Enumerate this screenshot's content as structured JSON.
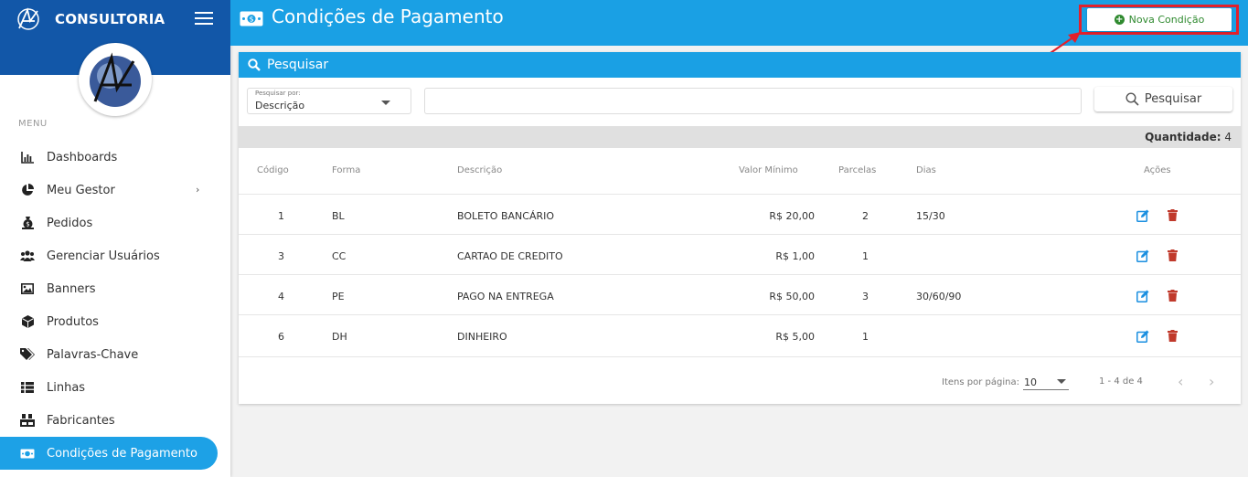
{
  "sidebar": {
    "brand": "CONSULTORIA",
    "menu_label": "MENU",
    "items": [
      {
        "label": "Dashboards",
        "icon": "chart-bar-icon"
      },
      {
        "label": "Meu Gestor",
        "icon": "pie-chart-icon"
      },
      {
        "label": "Pedidos",
        "icon": "money-bag-icon"
      },
      {
        "label": "Gerenciar Usuários",
        "icon": "users-icon"
      },
      {
        "label": "Banners",
        "icon": "image-icon"
      },
      {
        "label": "Produtos",
        "icon": "box-icon"
      },
      {
        "label": "Palavras-Chave",
        "icon": "tags-icon"
      },
      {
        "label": "Linhas",
        "icon": "list-icon"
      },
      {
        "label": "Fabricantes",
        "icon": "pallet-icon"
      },
      {
        "label": "Condições de Pagamento",
        "icon": "money-bill-icon"
      }
    ]
  },
  "header": {
    "title": "Condições de Pagamento",
    "nova_label": "Nova Condição"
  },
  "search": {
    "title": "Pesquisar",
    "select_label": "Pesquisar por:",
    "select_value": "Descrição",
    "button_label": "Pesquisar",
    "quantity_label": "Quantidade:",
    "quantity_value": "4"
  },
  "table": {
    "headers": [
      "Código",
      "Forma",
      "Descrição",
      "Valor Mínimo",
      "Parcelas",
      "Dias",
      "Ações"
    ],
    "rows": [
      {
        "codigo": "1",
        "forma": "BL",
        "descricao": "BOLETO BANCÁRIO",
        "valor": "R$ 20,00",
        "parcelas": "2",
        "dias": "15/30"
      },
      {
        "codigo": "3",
        "forma": "CC",
        "descricao": "CARTAO DE CREDITO",
        "valor": "R$ 1,00",
        "parcelas": "1",
        "dias": ""
      },
      {
        "codigo": "4",
        "forma": "PE",
        "descricao": "PAGO NA ENTREGA",
        "valor": "R$ 50,00",
        "parcelas": "3",
        "dias": "30/60/90"
      },
      {
        "codigo": "6",
        "forma": "DH",
        "descricao": "DINHEIRO",
        "valor": "R$ 5,00",
        "parcelas": "1",
        "dias": ""
      }
    ]
  },
  "pager": {
    "items_label": "Itens por página:",
    "items_value": "10",
    "range": "1 - 4 de 4"
  },
  "colors": {
    "sidebar_header": "#1257a8",
    "topbar": "#1aa0e4",
    "active_item": "#1da1e6",
    "annotation_red": "#e3202b",
    "nova_green": "#2f8a2f",
    "edit_blue": "#1a8fe0",
    "delete_red": "#c0392b"
  }
}
